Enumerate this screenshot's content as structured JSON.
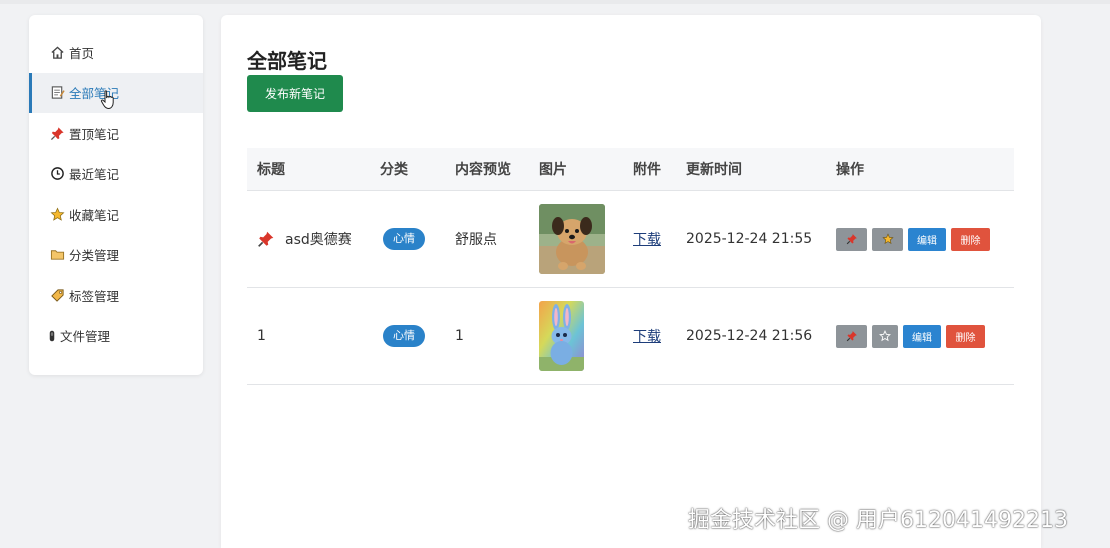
{
  "sidebar": {
    "items": [
      {
        "label": "首页",
        "icon": "home-icon"
      },
      {
        "label": "全部笔记",
        "icon": "note-icon",
        "active": true
      },
      {
        "label": "置顶笔记",
        "icon": "pin-icon"
      },
      {
        "label": "最近笔记",
        "icon": "clock-icon"
      },
      {
        "label": "收藏笔记",
        "icon": "star-icon"
      },
      {
        "label": "分类管理",
        "icon": "folder-icon"
      },
      {
        "label": "标签管理",
        "icon": "tag-icon"
      },
      {
        "label": "文件管理",
        "icon": "file-icon"
      }
    ]
  },
  "main": {
    "title": "全部笔记",
    "publish_label": "发布新笔记",
    "table": {
      "headers": [
        "标题",
        "分类",
        "内容预览",
        "图片",
        "附件",
        "更新时间",
        "操作"
      ],
      "rows": [
        {
          "title": "asd奥德赛",
          "pinned": true,
          "category": "心情",
          "preview": "舒服点",
          "image": "dog-photo",
          "attachment": "下载",
          "updated": "2025-12-24 21:55",
          "edit": "编辑",
          "delete": "删除"
        },
        {
          "title": "1",
          "pinned": false,
          "category": "心情",
          "preview": "1",
          "image": "bunny-image",
          "attachment": "下载",
          "updated": "2025-12-24 21:56",
          "edit": "编辑",
          "delete": "删除"
        }
      ]
    }
  },
  "watermark": "掘金技术社区 @ 用户612041492213",
  "colors": {
    "accent": "#2a7ab8",
    "publish": "#1f8a4d",
    "badge": "#2a82c9",
    "edit": "#2b84d0",
    "delete": "#e0533d",
    "grey_button": "#8e9499"
  }
}
